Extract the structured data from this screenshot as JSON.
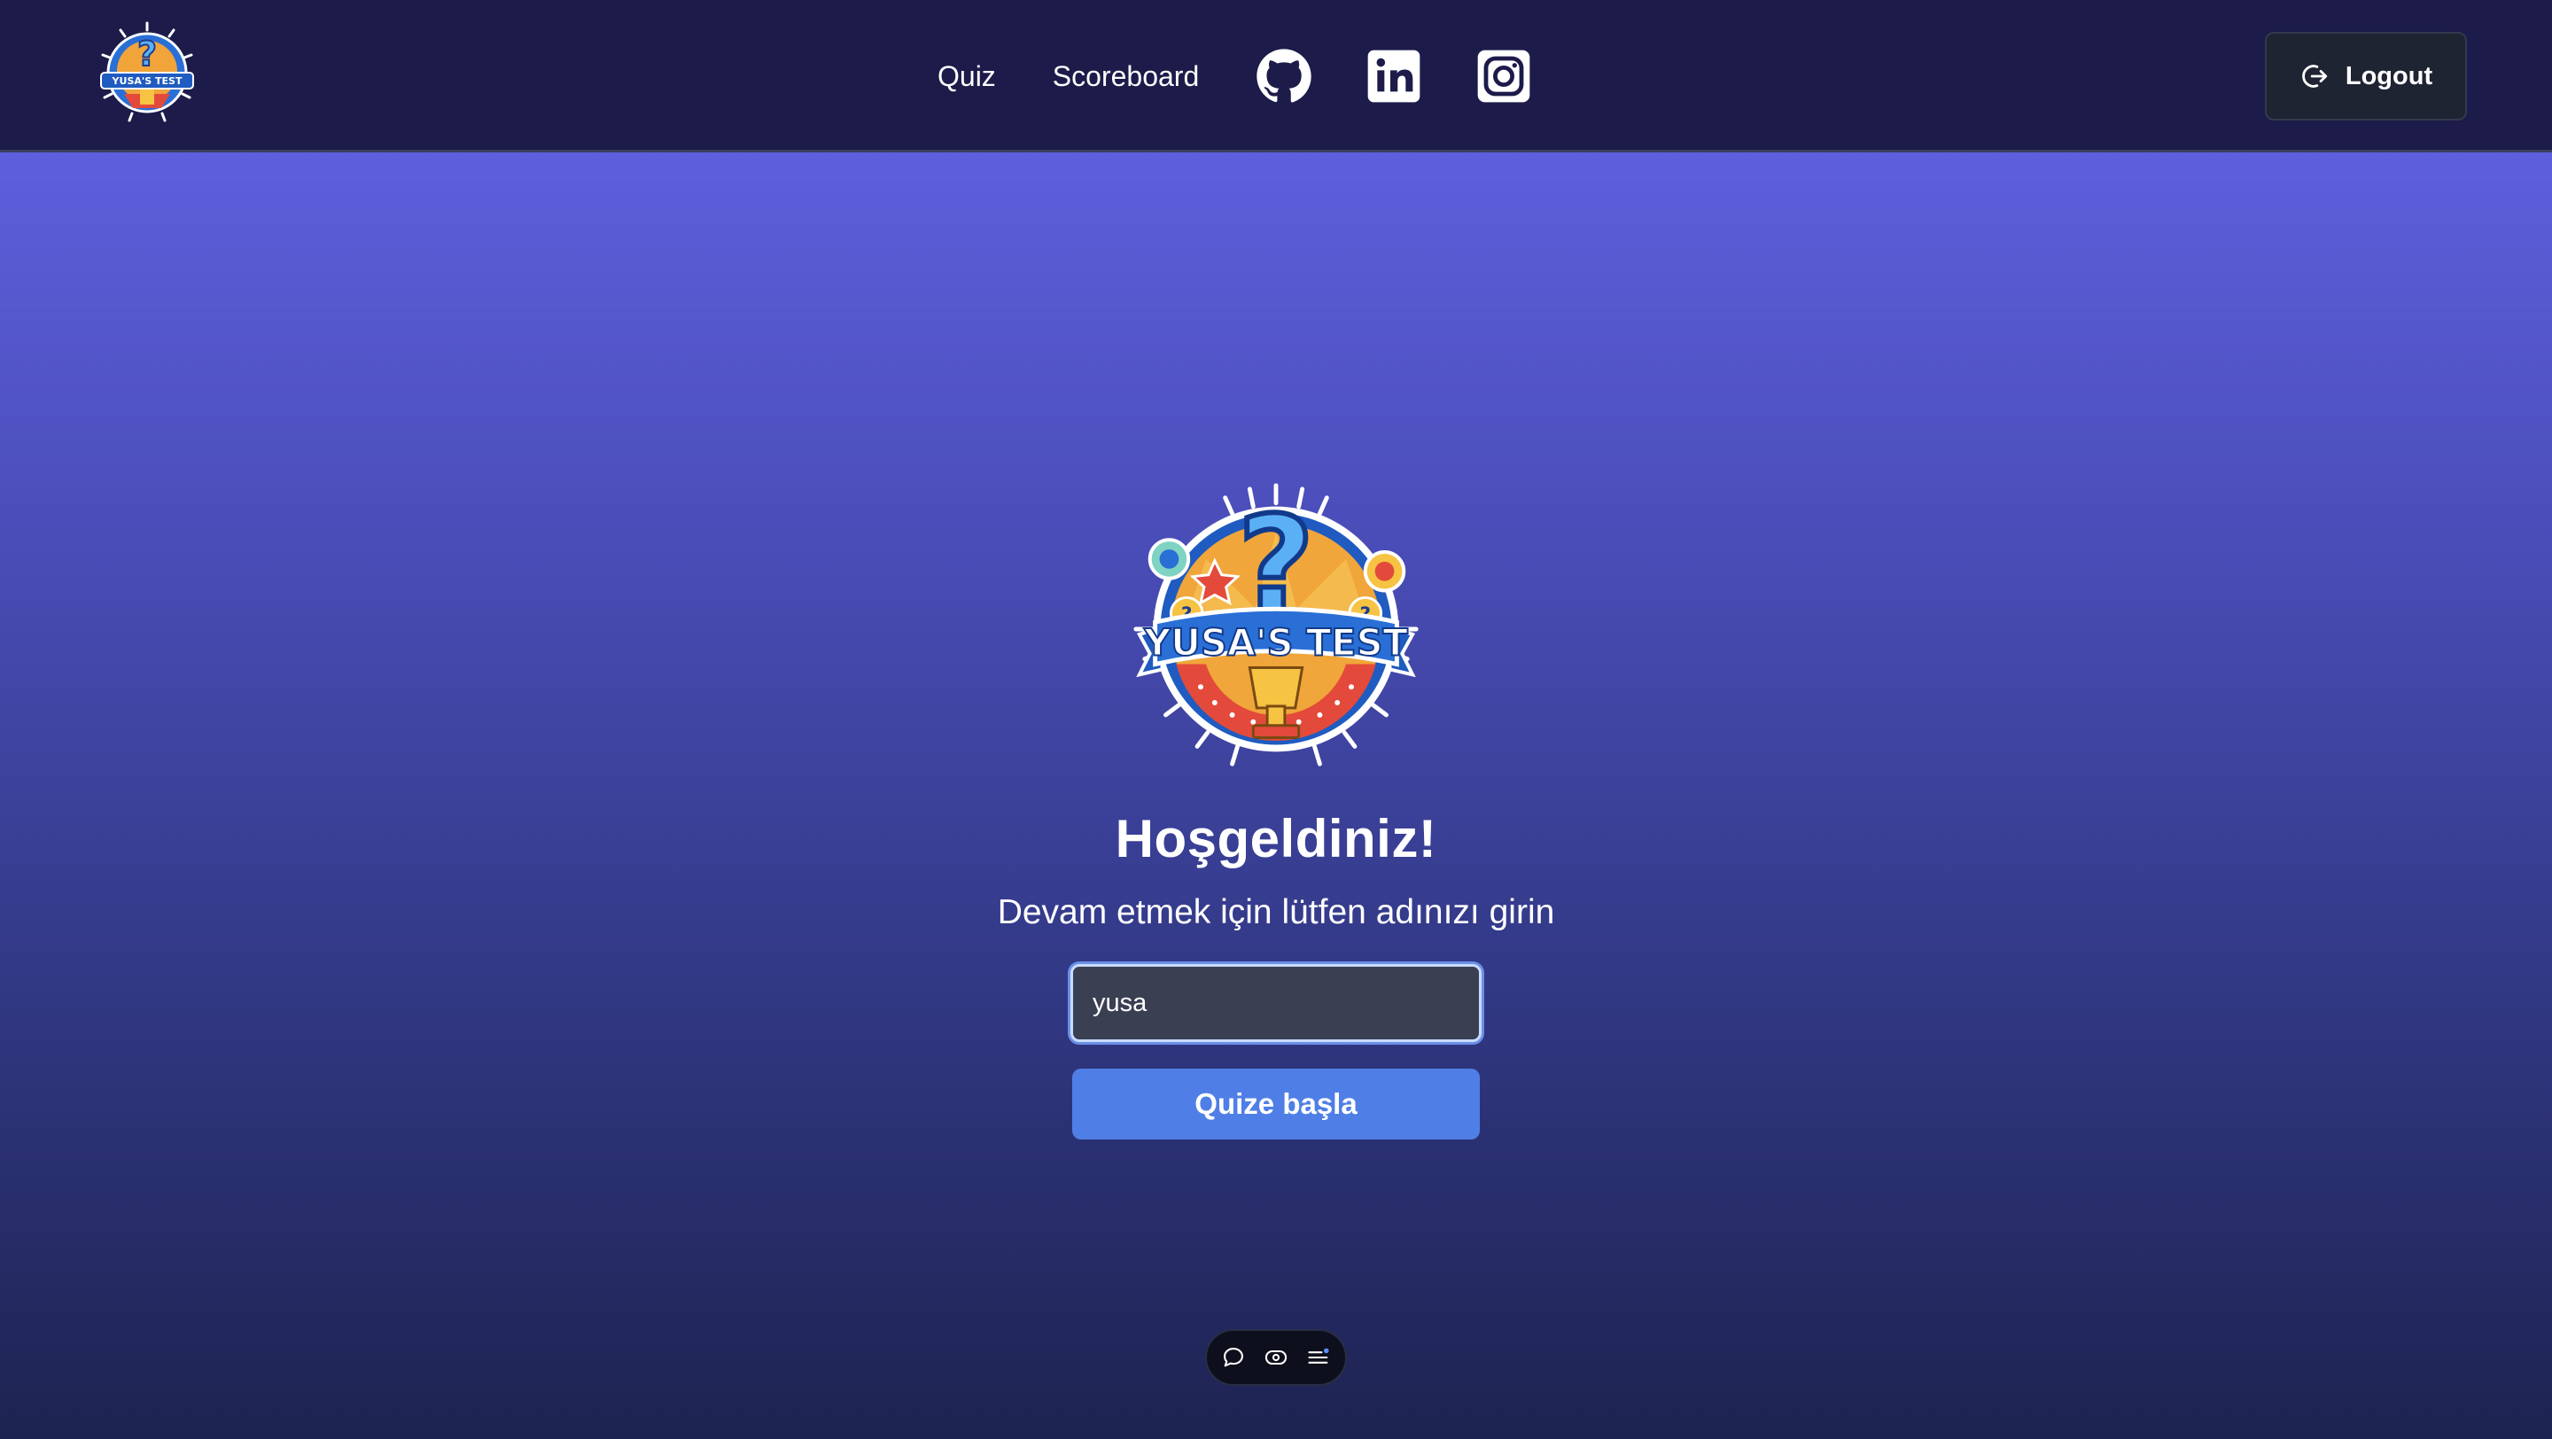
{
  "nav": {
    "logo_alt": "YUSA'S TEST",
    "links": [
      {
        "label": "Quiz"
      },
      {
        "label": "Scoreboard"
      }
    ],
    "socials": [
      "github-icon",
      "linkedin-icon",
      "instagram-icon"
    ],
    "logout_label": "Logout"
  },
  "hero": {
    "logo_text": "YUSA'S TEST",
    "title": "Hoşgeldiniz!",
    "subtitle": "Devam etmek için lütfen adınızı girin",
    "name_value": "yusa",
    "start_label": "Quize başla"
  },
  "toolbar": {
    "icons": [
      "comment-icon",
      "eye-toggle-icon",
      "list-menu-icon"
    ]
  },
  "colors": {
    "navbar_bg": "#1c1b4a",
    "gradient_top": "#5d5fdc",
    "gradient_bottom": "#1d2350",
    "button_primary": "#4f7fe6",
    "input_bg": "#3b3f52"
  }
}
